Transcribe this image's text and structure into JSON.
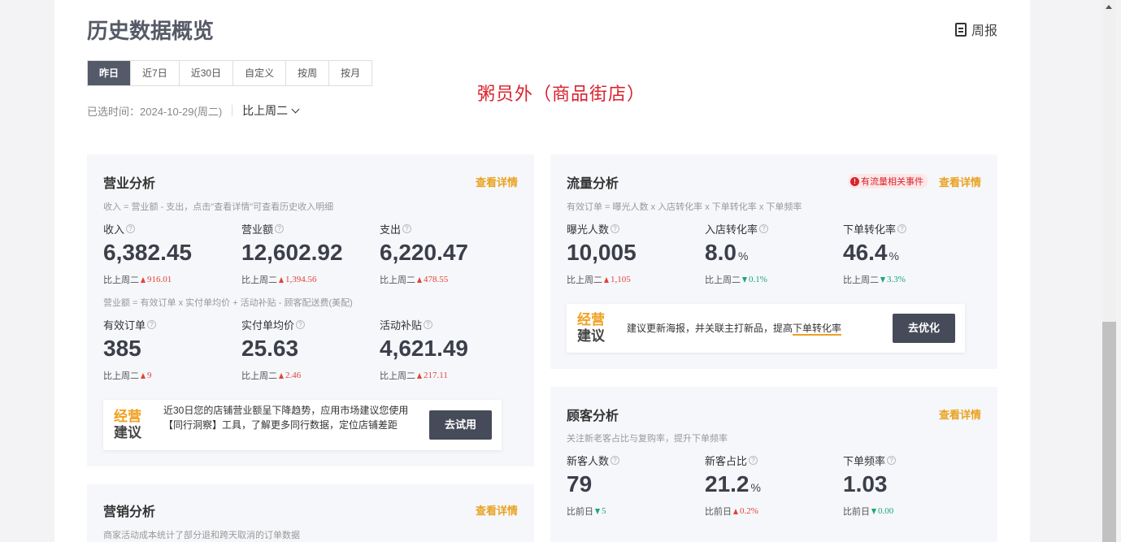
{
  "page": {
    "title": "历史数据概览",
    "weekly_report": "周报",
    "shop_name": "粥员外（商品街店）",
    "tabs": [
      {
        "label": "昨日",
        "active": true
      },
      {
        "label": "近7日",
        "active": false
      },
      {
        "label": "近30日",
        "active": false
      },
      {
        "label": "自定义",
        "active": false
      },
      {
        "label": "按周",
        "active": false
      },
      {
        "label": "按月",
        "active": false
      }
    ],
    "selected_time": "已选时间：2024-10-29(周二)",
    "compare": "比上周二"
  },
  "business": {
    "title": "营业分析",
    "link": "查看详情",
    "desc1": "收入 = 营业额 - 支出，点击\"查看详情\"可查看历史收入明细",
    "desc2": "营业额 = 有效订单 x 实付单均价 + 活动补贴 - 顾客配送费(美配)",
    "metrics": [
      {
        "label": "收入",
        "value": "6,382.45",
        "cmp_label": "比上周二",
        "delta": "916.01",
        "dir": "up"
      },
      {
        "label": "营业额",
        "value": "12,602.92",
        "cmp_label": "比上周二",
        "delta": "1,394.56",
        "dir": "up"
      },
      {
        "label": "支出",
        "value": "6,220.47",
        "cmp_label": "比上周二",
        "delta": "478.55",
        "dir": "up"
      },
      {
        "label": "有效订单",
        "value": "385",
        "cmp_label": "比上周二",
        "delta": "9",
        "dir": "up"
      },
      {
        "label": "实付单均价",
        "value": "25.63",
        "cmp_label": "比上周二",
        "delta": "2.46",
        "dir": "up"
      },
      {
        "label": "活动补贴",
        "value": "4,621.49",
        "cmp_label": "比上周二",
        "delta": "217.11",
        "dir": "up"
      }
    ],
    "advice": {
      "logo_line1": "经营",
      "logo_line2": "建议",
      "text": "近30日您的店铺营业额呈下降趋势，应用市场建议您使用【同行洞察】工具，了解更多同行数据，定位店铺差距",
      "button": "去试用"
    }
  },
  "traffic": {
    "title": "流量分析",
    "link": "查看详情",
    "event_badge": "有流量相关事件",
    "desc": "有效订单 = 曝光人数 x 入店转化率 x 下单转化率 x 下单频率",
    "metrics": [
      {
        "label": "曝光人数",
        "value": "10,005",
        "unit": "",
        "cmp_label": "比上周二",
        "delta": "1,105",
        "dir": "up"
      },
      {
        "label": "入店转化率",
        "value": "8.0",
        "unit": "%",
        "cmp_label": "比上周二",
        "delta": "0.1%",
        "dir": "down"
      },
      {
        "label": "下单转化率",
        "value": "46.4",
        "unit": "%",
        "cmp_label": "比上周二",
        "delta": "3.3%",
        "dir": "down"
      }
    ],
    "advice": {
      "logo_line1": "经营",
      "logo_line2": "建议",
      "text_before": "建议更新海报，并关联主打新品，提高",
      "text_highlight": "下单转化率",
      "button": "去优化"
    }
  },
  "customer": {
    "title": "顾客分析",
    "link": "查看详情",
    "desc": "关注新老客占比与复购率，提升下单频率",
    "metrics": [
      {
        "label": "新客人数",
        "value": "79",
        "unit": "",
        "cmp_label": "比前日",
        "delta": "5",
        "dir": "down"
      },
      {
        "label": "新客占比",
        "value": "21.2",
        "unit": "%",
        "cmp_label": "比前日",
        "delta": "0.2%",
        "dir": "up"
      },
      {
        "label": "下单频率",
        "value": "1.03",
        "unit": "",
        "cmp_label": "比前日",
        "delta": "0.00",
        "dir": "down"
      }
    ]
  },
  "marketing": {
    "title": "营销分析",
    "link": "查看详情",
    "desc": "商家活动成本统计了部分退和跨天取消的订单数据"
  }
}
